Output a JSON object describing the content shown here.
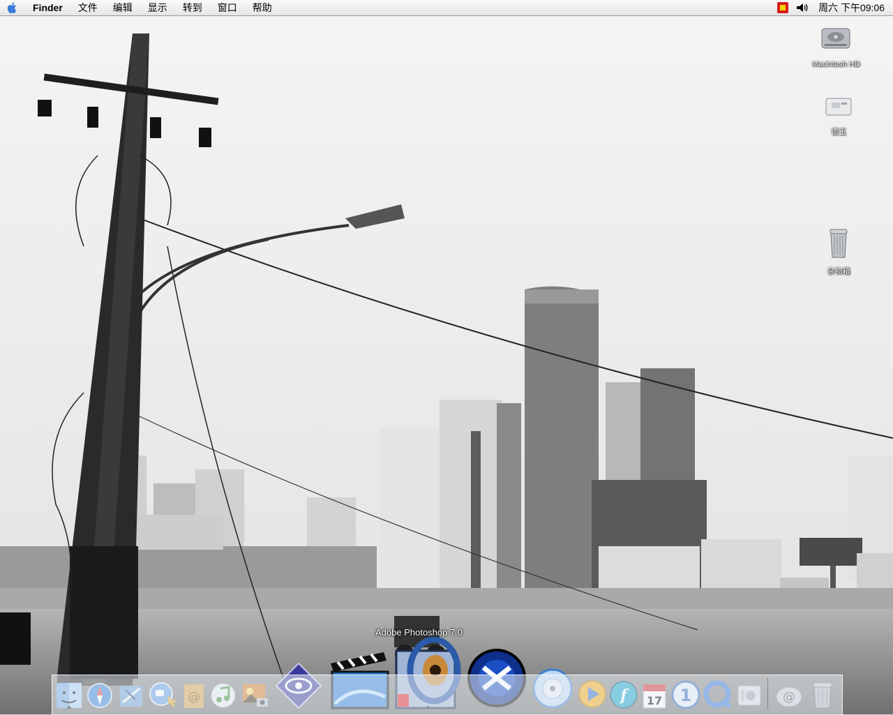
{
  "menubar": {
    "app_name": "Finder",
    "items": [
      "文件",
      "编辑",
      "显示",
      "转到",
      "窗口",
      "帮助"
    ],
    "clock": "周六 下午09:06"
  },
  "desktop_icons": [
    {
      "label": "Macintosh HD",
      "icon": "hard-drive-icon"
    },
    {
      "label": "德玉",
      "icon": "network-volume-icon"
    },
    {
      "label": "杂物箱",
      "icon": "trash-can-icon"
    }
  ],
  "dock": {
    "tooltip": "Adobe Photoshop 7.0",
    "apps": [
      {
        "name": "finder-icon"
      },
      {
        "name": "safari-icon"
      },
      {
        "name": "mail-icon"
      },
      {
        "name": "ichat-icon"
      },
      {
        "name": "address-book-icon"
      },
      {
        "name": "itunes-icon"
      },
      {
        "name": "iphoto-icon"
      },
      {
        "name": "ieye-icon"
      },
      {
        "name": "imovie-icon"
      },
      {
        "name": "photoshop-icon"
      },
      {
        "name": "x-gear-icon"
      },
      {
        "name": "ipod-sync-icon"
      },
      {
        "name": "quicktime-play-icon"
      },
      {
        "name": "flash-icon"
      },
      {
        "name": "ical-icon",
        "text": "17"
      },
      {
        "name": "one-icon",
        "text": "1"
      },
      {
        "name": "quicktime-icon"
      },
      {
        "name": "system-prefs-icon"
      },
      {
        "name": "mail-at-icon"
      },
      {
        "name": "trash-dock-icon"
      }
    ]
  },
  "colors": {
    "menubar": "#ececec",
    "sky": "#e9e9e9",
    "ground": "#8c8c8c",
    "dock": "#dfe6ec"
  }
}
